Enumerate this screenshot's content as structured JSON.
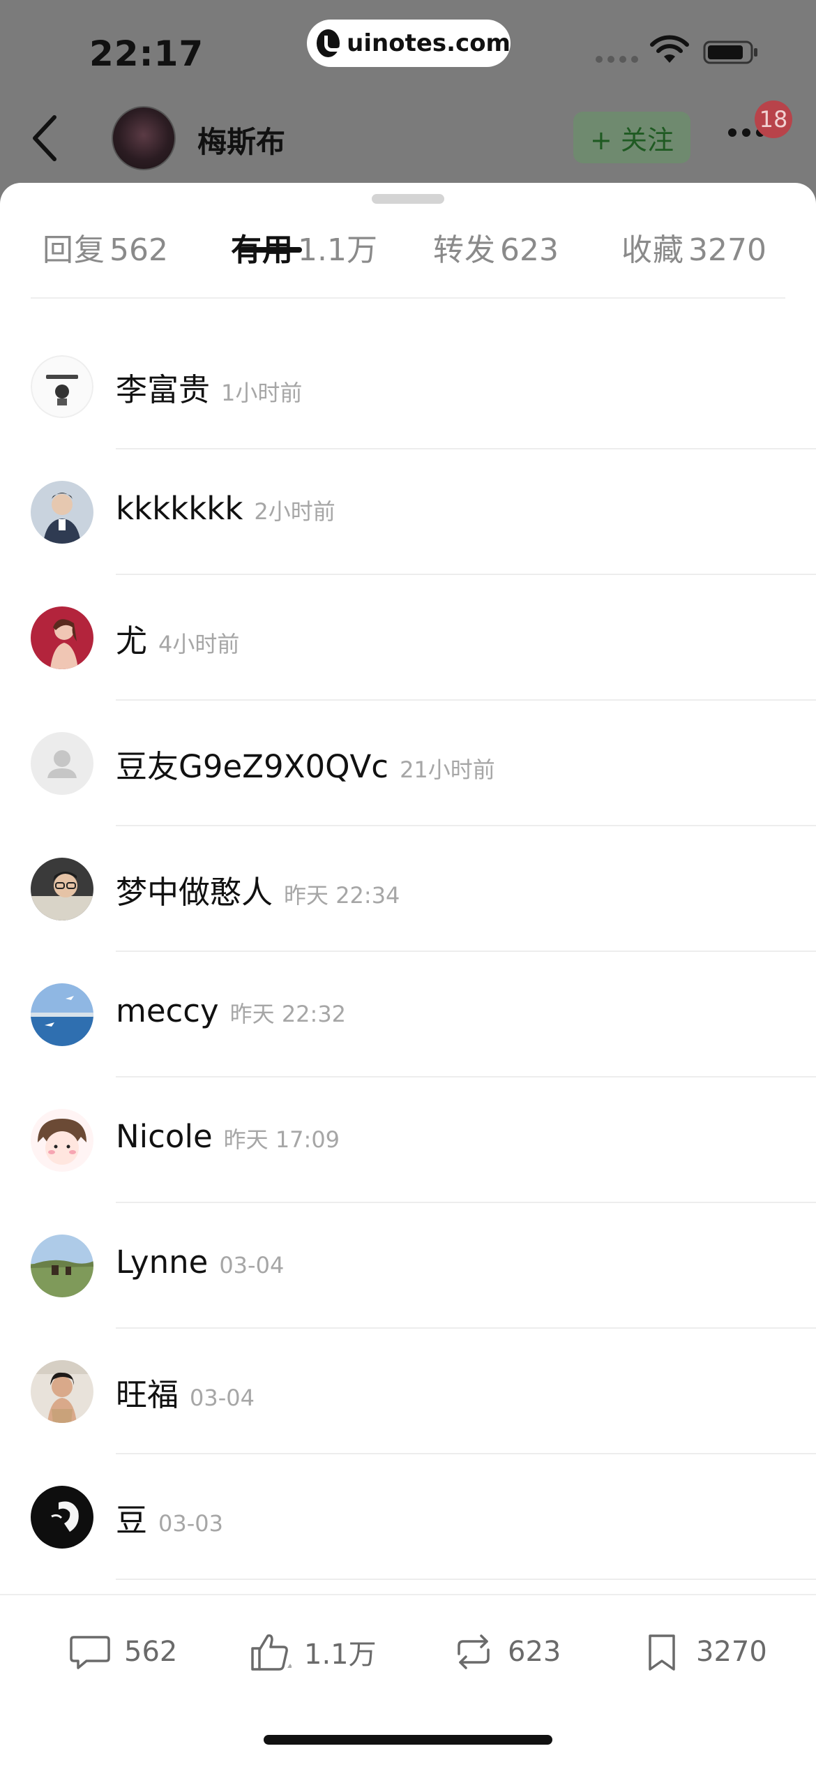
{
  "status_bar": {
    "time": "22:17",
    "watermark": "uinotes.com"
  },
  "header": {
    "author_name": "梅斯布",
    "follow_label": "+ 关注",
    "notification_count": "18"
  },
  "tabs": [
    {
      "label": "回复",
      "count": "562"
    },
    {
      "label": "有用",
      "count": "1.1万",
      "active": true
    },
    {
      "label": "转发",
      "count": "623"
    },
    {
      "label": "收藏",
      "count": "3270"
    }
  ],
  "users": [
    {
      "name": "李富贵",
      "time": "1小时前",
      "avatar": "li-fugui-avatar"
    },
    {
      "name": "kkkkkkk",
      "time": "2小时前",
      "avatar": "kkkkkkk-avatar"
    },
    {
      "name": "尤",
      "time": "4小时前",
      "avatar": "you-avatar"
    },
    {
      "name": "豆友G9eZ9X0QVc",
      "time": "21小时前",
      "avatar": "default-person-avatar"
    },
    {
      "name": "梦中做憨人",
      "time": "昨天 22:34",
      "avatar": "mengzhong-avatar"
    },
    {
      "name": "meccy",
      "time": "昨天 22:32",
      "avatar": "meccy-avatar"
    },
    {
      "name": "Nicole",
      "time": "昨天 17:09",
      "avatar": "nicole-avatar"
    },
    {
      "name": "Lynne",
      "time": "03-04",
      "avatar": "lynne-avatar"
    },
    {
      "name": "旺福",
      "time": "03-04",
      "avatar": "wangfu-avatar"
    },
    {
      "name": "豆",
      "time": "03-03",
      "avatar": "dou-avatar"
    }
  ],
  "bottom_actions": [
    {
      "icon": "comment-icon",
      "count": "562"
    },
    {
      "icon": "thumbs-up-icon",
      "count": "1.1万"
    },
    {
      "icon": "repost-icon",
      "count": "623"
    },
    {
      "icon": "bookmark-icon",
      "count": "3270"
    }
  ],
  "colors": {
    "accent_green": "#1f5a22",
    "badge_red": "#b8434a",
    "muted_text": "#a6a6a6"
  }
}
